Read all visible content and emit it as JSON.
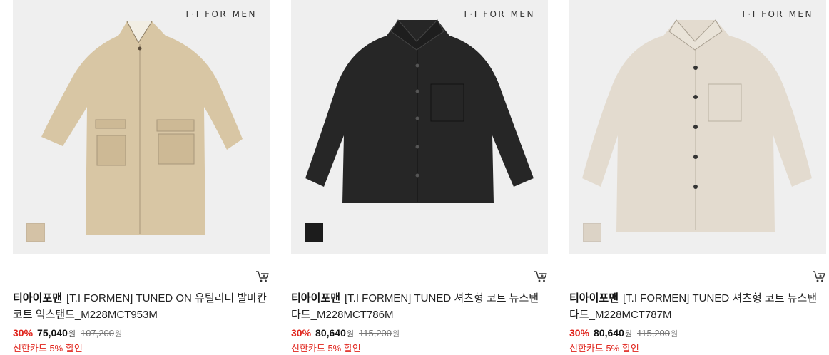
{
  "products": [
    {
      "brand_mark": "T·I FOR MEN",
      "brand": "티아이포맨",
      "name": "[T.I FORMEN] TUNED ON 유틸리티 발마칸 코트 익스탠드_M228MCT953M",
      "discount": "30%",
      "price": "75,040",
      "currency": "원",
      "original_price": "107,200",
      "original_currency": "원",
      "promo": "신한카드 5% 할인",
      "swatch_color": "#d4c2a6",
      "coat_color": "#d8c6a4"
    },
    {
      "brand_mark": "T·I FOR MEN",
      "brand": "티아이포맨",
      "name": "[T.I FORMEN] TUNED 셔츠형 코트 뉴스탠다드_M228MCT786M",
      "discount": "30%",
      "price": "80,640",
      "currency": "원",
      "original_price": "115,200",
      "original_currency": "원",
      "promo": "신한카드 5% 할인",
      "swatch_color": "#1c1c1c",
      "coat_color": "#262626"
    },
    {
      "brand_mark": "T·I FOR MEN",
      "brand": "티아이포맨",
      "name": "[T.I FORMEN] TUNED 셔츠형 코트 뉴스탠다드_M228MCT787M",
      "discount": "30%",
      "price": "80,640",
      "currency": "원",
      "original_price": "115,200",
      "original_currency": "원",
      "promo": "신한카드 5% 할인",
      "swatch_color": "#dcd3c6",
      "coat_color": "#e3dbcf"
    }
  ],
  "icons": {
    "cart": "cart-icon"
  }
}
